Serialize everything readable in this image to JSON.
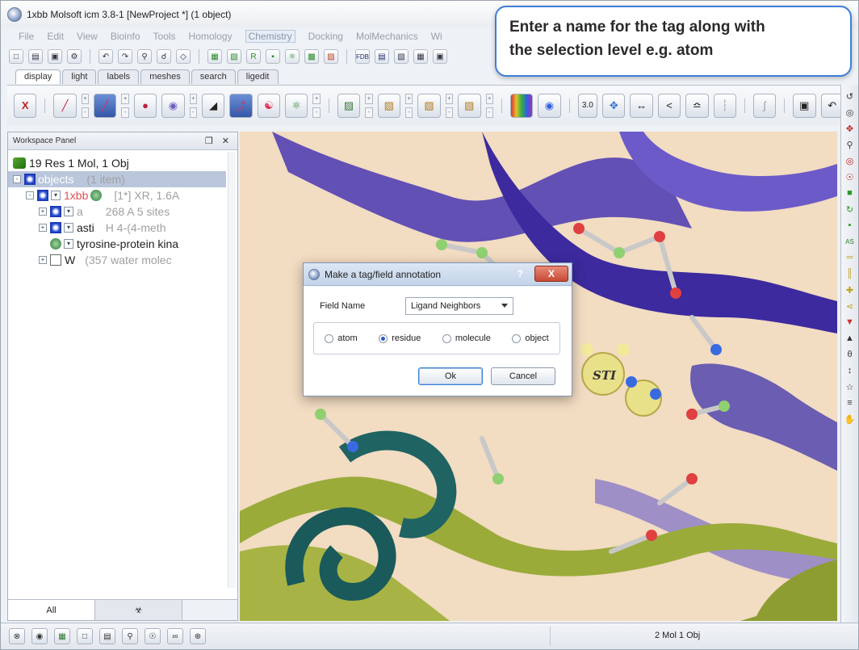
{
  "window": {
    "title": "1xbb Molsoft icm 3.8-1  [NewProject *] (1 object)"
  },
  "menu": [
    "File",
    "Edit",
    "View",
    "Bioinfo",
    "Tools",
    "Homology",
    "Chemistry",
    "Docking",
    "MolMechanics",
    "Wi"
  ],
  "tabs": [
    "display",
    "light",
    "labels",
    "meshes",
    "search",
    "ligedit"
  ],
  "callout": {
    "line1": "Enter a name for the tag along with",
    "line2": "the selection level e.g. atom"
  },
  "workspace": {
    "title": "Workspace Panel",
    "controls": "❒ ✕",
    "summary": "19 Res 1 Mol, 1 Obj",
    "rows": [
      {
        "label": "objects",
        "extra": "(1 item)"
      },
      {
        "label": "1xbb",
        "extra": "[1*] XR, 1.6A"
      },
      {
        "label": "a",
        "extra": "268 A  5 sites"
      },
      {
        "label": "asti",
        "extra": "H  4-(4-meth"
      },
      {
        "label": "tyrosine-protein kina",
        "extra": ""
      },
      {
        "label": "W",
        "extra": "(357 water molec"
      }
    ],
    "tab_all": "All",
    "tab_second": "☣"
  },
  "dialog": {
    "title": "Make a tag/field annotation",
    "help": "?",
    "close": "X",
    "field_label": "Field Name",
    "field_value": "Ligand Neighbors",
    "options": [
      "atom",
      "residue",
      "molecule",
      "object"
    ],
    "selected": "residue",
    "ok": "Ok",
    "cancel": "Cancel"
  },
  "viewer": {
    "ligand_label": "STI"
  },
  "toolbar2": {
    "thickness_value": "3.0"
  },
  "status": {
    "text": "2 Mol 1 Obj"
  },
  "colors": {
    "accent": "#3e7ed6",
    "background_viewer": "#f2dcc2",
    "ribbon_purple": "#5a48b4",
    "ribbon_olive": "#9aab3a",
    "ribbon_teal": "#1a5a5a"
  }
}
